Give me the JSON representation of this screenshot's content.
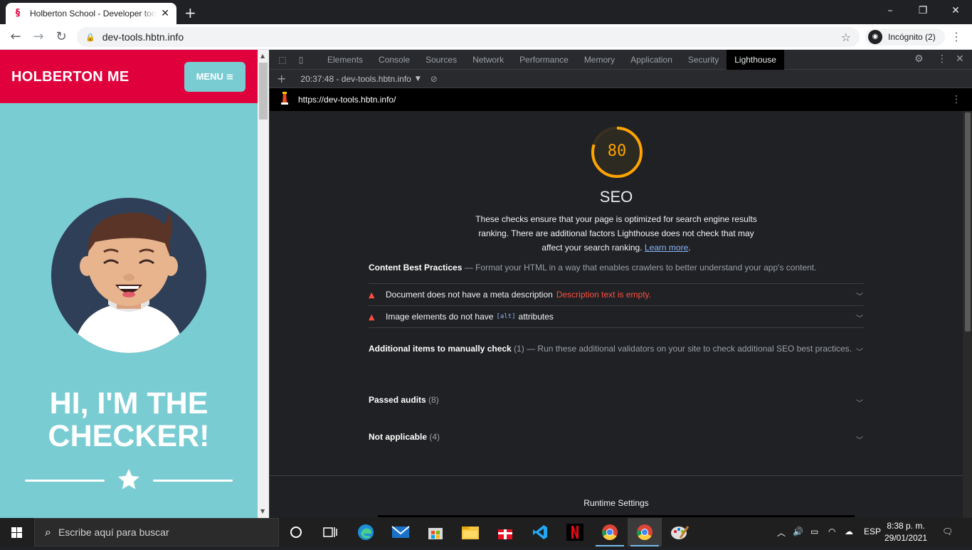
{
  "browser": {
    "tab_title": "Holberton School - Developer tools",
    "url": "dev-tools.hbtn.info",
    "incognito_label": "Incógnito (2)"
  },
  "page": {
    "brand": "HOLBERTON ME",
    "menu_label": "MENU",
    "headline_line1": "HI, I'M THE",
    "headline_line2": "CHECKER!"
  },
  "devtools": {
    "tabs": [
      "Elements",
      "Console",
      "Sources",
      "Network",
      "Performance",
      "Memory",
      "Application",
      "Security",
      "Lighthouse"
    ],
    "active_tab": "Lighthouse",
    "report_select": "20:37:48 - dev-tools.hbtn.info",
    "report_url": "https://dev-tools.hbtn.info/"
  },
  "lighthouse": {
    "score": "80",
    "score_fraction": 0.8,
    "score_color": "#ffa400",
    "category_title": "SEO",
    "description": "These checks ensure that your page is optimized for search engine results ranking. There are additional factors Lighthouse does not check that may affect your search ranking.",
    "learn_more": "Learn more",
    "content_group": {
      "title": "Content Best Practices",
      "dash": "—",
      "subtitle": "Format your HTML in a way that enables crawlers to better understand your app's content."
    },
    "audits": [
      {
        "title": "Document does not have a meta description",
        "detail": "Description text is empty."
      },
      {
        "title_before": "Image elements do not have",
        "code": "[alt]",
        "title_after": "attributes"
      }
    ],
    "manual": {
      "title": "Additional items to manually check",
      "count": "(1)",
      "dash": "—",
      "subtitle": "Run these additional validators on your site to check additional SEO best practices."
    },
    "passed": {
      "title": "Passed audits",
      "count": "(8)"
    },
    "not_applicable": {
      "title": "Not applicable",
      "count": "(4)"
    },
    "runtime_settings": "Runtime Settings"
  },
  "taskbar": {
    "search_placeholder": "Escribe aquí para buscar",
    "language": "ESP",
    "time": "8:38 p. m.",
    "date": "29/01/2021"
  },
  "colors": {
    "brand_red": "#e0003c",
    "page_teal": "#7accd3",
    "fail_red": "#ff4e42"
  }
}
